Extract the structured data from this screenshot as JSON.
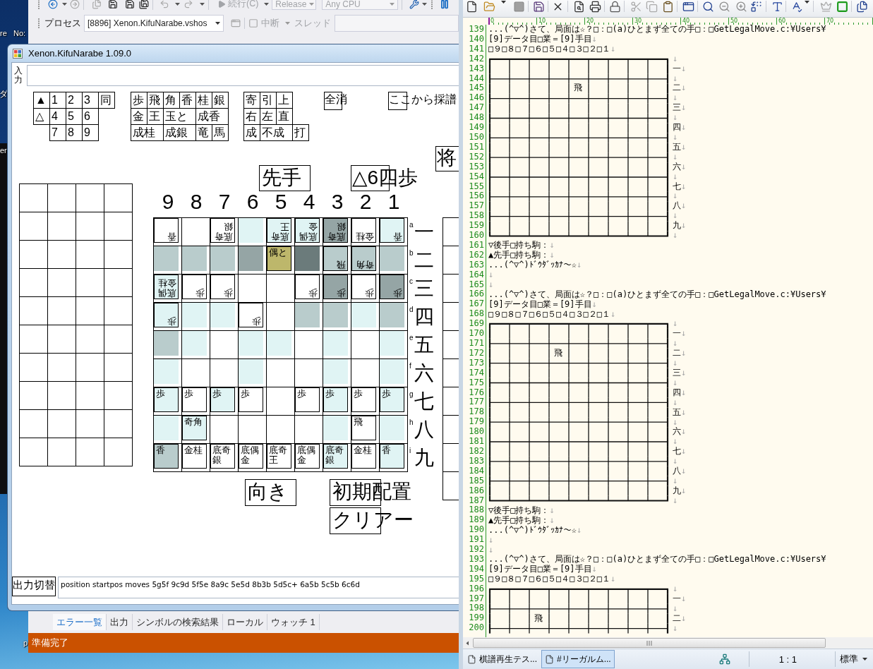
{
  "desktop": {
    "labels": [
      "re",
      "No:",
      "ダ",
      "er",
      "p"
    ]
  },
  "ide": {
    "toolbar": {
      "continue": {
        "label": "続行(C)",
        "disabled": true
      },
      "configuration": {
        "value": "Release",
        "disabled": true
      },
      "platform": {
        "value": "Any CPU",
        "disabled": true
      },
      "process_label": "プロセス",
      "process": "[8896] Xenon.KifuNarabe.vshos",
      "break": {
        "label": "中断",
        "disabled": true
      },
      "thread": {
        "label": "スレッド",
        "disabled": true
      }
    },
    "tool_tabs": [
      {
        "label": "エラー一覧",
        "selected": true
      },
      {
        "label": "出力",
        "selected": false
      },
      {
        "label": "シンボルの検索結果",
        "selected": false
      },
      {
        "label": "ローカル",
        "selected": false
      },
      {
        "label": "ウォッチ 1",
        "selected": false
      }
    ],
    "status": "準備完了"
  },
  "kifu_window": {
    "title": "Xenon.KifuNarabe 1.09.0",
    "input_label": "入力",
    "key_groups": [
      {
        "rows": [
          {
            "keys": [
              {
                "kind": "key",
                "label": "▲"
              },
              {
                "kind": "key",
                "label": "1"
              },
              {
                "kind": "key",
                "label": "2"
              },
              {
                "kind": "key",
                "label": "3"
              },
              {
                "kind": "key",
                "label": "同"
              }
            ]
          },
          {
            "keys": [
              {
                "kind": "key",
                "label": "△"
              },
              {
                "kind": "key",
                "label": "4"
              },
              {
                "kind": "key",
                "label": "5"
              },
              {
                "kind": "key",
                "label": "6"
              }
            ]
          },
          {
            "keys": [
              {
                "kind": "gap"
              },
              {
                "kind": "key",
                "label": "7"
              },
              {
                "kind": "key",
                "label": "8"
              },
              {
                "kind": "key",
                "label": "9"
              }
            ]
          }
        ]
      },
      {
        "rows": [
          {
            "keys": [
              {
                "kind": "key",
                "label": "歩"
              },
              {
                "kind": "key",
                "label": "飛"
              },
              {
                "kind": "key",
                "label": "角"
              },
              {
                "kind": "key",
                "label": "香"
              },
              {
                "kind": "key",
                "label": "桂"
              },
              {
                "kind": "key",
                "label": "銀"
              }
            ]
          },
          {
            "keys": [
              {
                "kind": "key",
                "label": "金"
              },
              {
                "kind": "key",
                "label": "王"
              },
              {
                "kind": "key",
                "label": "玉と",
                "wide": true
              },
              {
                "kind": "key",
                "label": "成香",
                "wide": true
              }
            ]
          },
          {
            "keys": [
              {
                "kind": "key",
                "label": "成桂",
                "wide": true
              },
              {
                "kind": "key",
                "label": "成銀",
                "wide": true
              },
              {
                "kind": "key",
                "label": "竜"
              },
              {
                "kind": "key",
                "label": "馬"
              }
            ]
          }
        ]
      },
      {
        "rows": [
          {
            "keys": [
              {
                "kind": "key",
                "label": "寄"
              },
              {
                "kind": "key",
                "label": "引"
              },
              {
                "kind": "key",
                "label": "上"
              }
            ]
          },
          {
            "keys": [
              {
                "kind": "key",
                "label": "右"
              },
              {
                "kind": "key",
                "label": "左"
              },
              {
                "kind": "key",
                "label": "直"
              }
            ]
          },
          {
            "keys": [
              {
                "kind": "key",
                "label": "成"
              },
              {
                "kind": "key",
                "label": "不成",
                "wide": true
              },
              {
                "kind": "key",
                "label": "打"
              }
            ]
          }
        ]
      }
    ],
    "clear_button": "全消",
    "record_button": "ここから採譜",
    "side_button": "将",
    "turn_button": "先手",
    "last_move": "△6四歩",
    "board": {
      "files": [
        "9",
        "8",
        "7",
        "6",
        "5",
        "4",
        "3",
        "2",
        "1"
      ],
      "ranks": [
        {
          "letter": "a",
          "kanji": "一"
        },
        {
          "letter": "b",
          "kanji": "二"
        },
        {
          "letter": "c",
          "kanji": "三"
        },
        {
          "letter": "d",
          "kanji": "四"
        },
        {
          "letter": "e",
          "kanji": "五"
        },
        {
          "letter": "f",
          "kanji": "六"
        },
        {
          "letter": "g",
          "kanji": "七"
        },
        {
          "letter": "h",
          "kanji": "八"
        },
        {
          "letter": "i",
          "kanji": "九"
        }
      ],
      "squares": [
        [
          {
            "occupied": true,
            "label": "香",
            "inverted": true
          },
          {
            "occupied": false
          },
          {
            "occupied": true,
            "label": "底奇銀",
            "inverted": true
          },
          {
            "occupied": false,
            "color": "#e0f4f4"
          },
          {
            "occupied": true,
            "label": "底奇王",
            "inverted": true,
            "color": "#e0f4f4"
          },
          {
            "occupied": true,
            "label": "底偶金",
            "inverted": true,
            "color": "#e0f4f4"
          },
          {
            "occupied": true,
            "label": "底奇銀",
            "inverted": true,
            "color": "#95a5a5"
          },
          {
            "occupied": true,
            "label": "金桂",
            "inverted": true
          },
          {
            "occupied": true,
            "label": "香",
            "inverted": true,
            "color": "#e0f4f4"
          }
        ],
        [
          {
            "occupied": false,
            "color": "#b9cccc"
          },
          {
            "occupied": false,
            "color": "#b9cccc"
          },
          {
            "occupied": false,
            "color": "#b9cccc"
          },
          {
            "occupied": false,
            "color": "#95a5a5"
          },
          {
            "occupied": true,
            "label": "偶と",
            "inverted": false,
            "color": "#bdb76b"
          },
          {
            "occupied": false,
            "color": "#6b7b7b"
          },
          {
            "occupied": true,
            "label": "飛",
            "inverted": true,
            "color": "#b9cccc"
          },
          {
            "occupied": true,
            "label": "奇角",
            "inverted": true,
            "color": "#b9cccc"
          },
          {
            "occupied": false,
            "color": "#b9cccc"
          }
        ],
        [
          {
            "occupied": true,
            "label": "底偶金桂",
            "inverted": true,
            "color": "#e0f4f4"
          },
          {
            "occupied": true,
            "label": "歩",
            "inverted": true
          },
          {
            "occupied": true,
            "label": "歩",
            "inverted": true
          },
          {
            "occupied": false
          },
          {
            "occupied": false
          },
          {
            "occupied": true,
            "label": "歩",
            "inverted": true
          },
          {
            "occupied": true,
            "label": "歩",
            "inverted": true,
            "color": "#95a5a5"
          },
          {
            "occupied": true,
            "label": "歩",
            "inverted": true
          },
          {
            "occupied": true,
            "label": "歩",
            "inverted": true,
            "color": "#95a5a5"
          }
        ],
        [
          {
            "occupied": true,
            "label": "歩",
            "inverted": true,
            "color": "#e0f4f4"
          },
          {
            "occupied": false,
            "color": "#e0f4f4"
          },
          {
            "occupied": false,
            "color": "#e0f4f4"
          },
          {
            "occupied": true,
            "label": "歩",
            "inverted": true
          },
          {
            "occupied": false
          },
          {
            "occupied": false,
            "color": "#b9cccc"
          },
          {
            "occupied": false,
            "color": "#b9cccc"
          },
          {
            "occupied": false,
            "color": "#e0f4f4"
          },
          {
            "occupied": false,
            "color": "#b9cccc"
          }
        ],
        [
          {
            "occupied": false,
            "color": "#b9cccc"
          },
          {
            "occupied": false,
            "color": "#e0f4f4"
          },
          {
            "occupied": false
          },
          {
            "occupied": false,
            "color": "#e0f4f4"
          },
          {
            "occupied": false,
            "color": "#e0f4f4"
          },
          {
            "occupied": false
          },
          {
            "occupied": false,
            "color": "#e0f4f4"
          },
          {
            "occupied": false
          },
          {
            "occupied": false,
            "color": "#e0f4f4"
          }
        ],
        [
          {
            "occupied": false,
            "color": "#e0f4f4"
          },
          {
            "occupied": false
          },
          {
            "occupied": false
          },
          {
            "occupied": false,
            "color": "#e0f4f4"
          },
          {
            "occupied": false
          },
          {
            "occupied": false
          },
          {
            "occupied": false,
            "color": "#e0f4f4"
          },
          {
            "occupied": false
          },
          {
            "occupied": false,
            "color": "#e0f4f4"
          }
        ],
        [
          {
            "occupied": true,
            "label": "歩",
            "inverted": false,
            "color": "#e0f4f4"
          },
          {
            "occupied": true,
            "label": "歩",
            "inverted": false
          },
          {
            "occupied": true,
            "label": "歩",
            "inverted": false,
            "color": "#e0f4f4"
          },
          {
            "occupied": true,
            "label": "歩",
            "inverted": false
          },
          {
            "occupied": false
          },
          {
            "occupied": true,
            "label": "歩",
            "inverted": false
          },
          {
            "occupied": true,
            "label": "歩",
            "inverted": false,
            "color": "#e0f4f4"
          },
          {
            "occupied": true,
            "label": "歩",
            "inverted": false
          },
          {
            "occupied": true,
            "label": "歩",
            "inverted": false,
            "color": "#e0f4f4"
          }
        ],
        [
          {
            "occupied": false,
            "color": "#e0f4f4"
          },
          {
            "occupied": true,
            "label": "奇角",
            "inverted": false,
            "color": "#e0f4f4"
          },
          {
            "occupied": false
          },
          {
            "occupied": false
          },
          {
            "occupied": false
          },
          {
            "occupied": false
          },
          {
            "occupied": false,
            "color": "#e0f4f4"
          },
          {
            "occupied": true,
            "label": "飛",
            "inverted": false
          },
          {
            "occupied": false,
            "color": "#e0f4f4"
          }
        ],
        [
          {
            "occupied": true,
            "label": "香",
            "inverted": false,
            "color": "#b9cccc"
          },
          {
            "occupied": true,
            "label": "金桂",
            "inverted": false
          },
          {
            "occupied": true,
            "label": "底奇銀",
            "inverted": false
          },
          {
            "occupied": true,
            "label": "底偶金",
            "inverted": false
          },
          {
            "occupied": true,
            "label": "底奇王",
            "inverted": false
          },
          {
            "occupied": true,
            "label": "底偶金",
            "inverted": false
          },
          {
            "occupied": true,
            "label": "底奇銀",
            "inverted": false,
            "color": "#e0f4f4"
          },
          {
            "occupied": true,
            "label": "金桂",
            "inverted": false
          },
          {
            "occupied": true,
            "label": "香",
            "inverted": false,
            "color": "#e0f4f4"
          }
        ]
      ]
    },
    "direction_button": "向き",
    "setup_button": "初期配置",
    "clear_board_button": "クリアー",
    "output_button": "出力切替",
    "output": "position startpos moves 5g5f 9c9d 5f5e 8a9c 5e5d 8b3b 5d5c+ 6a5b 5c5b 6c6d"
  },
  "editor": {
    "ruler": [
      "0",
      "10",
      "20",
      "30",
      "40",
      "50",
      "60",
      "70"
    ],
    "blocks": [
      {
        "kind": "text",
        "lines": [
          {
            "no": "139",
            "text": "...(^▽^)さて、局面は☆？□：□(a)ひとまず全ての手□：□GetLegalMove.c:¥Users¥"
          },
          {
            "no": "140",
            "text": "[9]データ目□業＝[9]手目",
            "eol": "↓"
          },
          {
            "no": "141",
            "text": "□９□８□７□６□５□４□３□２□１",
            "eol": "↓"
          }
        ]
      },
      {
        "kind": "board",
        "rows": [
          {
            "no": "142",
            "kind": "top",
            "eol": "↓"
          },
          {
            "no": "143",
            "kind": "rank",
            "rank": "一",
            "eol": "↓"
          },
          {
            "no": "144",
            "kind": "rule",
            "eol": "↓"
          },
          {
            "no": "145",
            "kind": "rank",
            "rank": "二",
            "eol": "↓",
            "cells": "　　　　飛"
          },
          {
            "no": "146",
            "kind": "rule",
            "eol": "↓"
          },
          {
            "no": "147",
            "kind": "rank",
            "rank": "三",
            "eol": "↓"
          },
          {
            "no": "148",
            "kind": "rule",
            "eol": "↓"
          },
          {
            "no": "149",
            "kind": "rank",
            "rank": "四",
            "eol": "↓"
          },
          {
            "no": "150",
            "kind": "rule",
            "eol": "↓"
          },
          {
            "no": "151",
            "kind": "rank",
            "rank": "五",
            "eol": "↓"
          },
          {
            "no": "152",
            "kind": "rule",
            "eol": "↓"
          },
          {
            "no": "153",
            "kind": "rank",
            "rank": "六",
            "eol": "↓"
          },
          {
            "no": "154",
            "kind": "rule",
            "eol": "↓"
          },
          {
            "no": "155",
            "kind": "rank",
            "rank": "七",
            "eol": "↓"
          },
          {
            "no": "156",
            "kind": "rule",
            "eol": "↓"
          },
          {
            "no": "157",
            "kind": "rank",
            "rank": "八",
            "eol": "↓"
          },
          {
            "no": "158",
            "kind": "rule",
            "eol": "↓"
          },
          {
            "no": "159",
            "kind": "rank",
            "rank": "九",
            "eol": "↓"
          },
          {
            "no": "160",
            "kind": "bottom",
            "eol": "↓"
          }
        ]
      },
      {
        "kind": "text",
        "lines": [
          {
            "no": "161",
            "text": "▽後手□持ち駒：",
            "eol": "↓"
          },
          {
            "no": "162",
            "text": "▲先手□持ち駒：",
            "eol": "↓"
          },
          {
            "no": "163",
            "text": "...(^▽^)ﾄﾞｳﾀﾞｯｶﾅ～☆",
            "eol": "↓"
          },
          {
            "no": "164",
            "eol": "↓"
          },
          {
            "no": "165",
            "eol": "↓"
          },
          {
            "no": "166",
            "text": "...(^▽^)さて、局面は☆？□：□(a)ひとまず全ての手□：□GetLegalMove.c:¥Users¥"
          },
          {
            "no": "167",
            "text": "[9]データ目□業＝[9]手目",
            "eol": "↓"
          },
          {
            "no": "168",
            "text": "□９□８□７□６□５□４□３□２□１",
            "eol": "↓"
          }
        ]
      },
      {
        "kind": "board",
        "rows": [
          {
            "no": "169",
            "kind": "top",
            "eol": "↓"
          },
          {
            "no": "170",
            "kind": "rank",
            "rank": "一",
            "eol": "↓"
          },
          {
            "no": "171",
            "kind": "rule",
            "eol": "↓"
          },
          {
            "no": "172",
            "kind": "rank",
            "rank": "二",
            "eol": "↓",
            "cells": "　　　飛"
          },
          {
            "no": "173",
            "kind": "rule",
            "eol": "↓"
          },
          {
            "no": "174",
            "kind": "rank",
            "rank": "三",
            "eol": "↓"
          },
          {
            "no": "175",
            "kind": "rule",
            "eol": "↓"
          },
          {
            "no": "176",
            "kind": "rank",
            "rank": "四",
            "eol": "↓"
          },
          {
            "no": "177",
            "kind": "rule",
            "eol": "↓"
          },
          {
            "no": "178",
            "kind": "rank",
            "rank": "五",
            "eol": "↓"
          },
          {
            "no": "179",
            "kind": "rule",
            "eol": "↓"
          },
          {
            "no": "180",
            "kind": "rank",
            "rank": "六",
            "eol": "↓"
          },
          {
            "no": "181",
            "kind": "rule",
            "eol": "↓"
          },
          {
            "no": "182",
            "kind": "rank",
            "rank": "七",
            "eol": "↓"
          },
          {
            "no": "183",
            "kind": "rule",
            "eol": "↓"
          },
          {
            "no": "184",
            "kind": "rank",
            "rank": "八",
            "eol": "↓"
          },
          {
            "no": "185",
            "kind": "rule",
            "eol": "↓"
          },
          {
            "no": "186",
            "kind": "rank",
            "rank": "九",
            "eol": "↓"
          },
          {
            "no": "187",
            "kind": "bottom",
            "eol": "↓"
          }
        ]
      },
      {
        "kind": "text",
        "lines": [
          {
            "no": "188",
            "text": "▽後手□持ち駒：",
            "eol": "↓"
          },
          {
            "no": "189",
            "text": "▲先手□持ち駒：",
            "eol": "↓"
          },
          {
            "no": "190",
            "text": "...(^▽^)ﾄﾞｳﾀﾞｯｶﾅ～☆",
            "eol": "↓"
          },
          {
            "no": "191",
            "eol": "↓"
          },
          {
            "no": "192",
            "eol": "↓"
          },
          {
            "no": "193",
            "text": "...(^▽^)さて、局面は☆？□：□(a)ひとまず全ての手□：□GetLegalMove.c:¥Users¥"
          },
          {
            "no": "194",
            "text": "[9]データ目□業＝[9]手目",
            "eol": "↓"
          },
          {
            "no": "195",
            "text": "□９□８□７□６□５□４□３□２□１",
            "eol": "↓"
          }
        ]
      },
      {
        "kind": "board",
        "rows": [
          {
            "no": "196",
            "kind": "top",
            "eol": "↓"
          },
          {
            "no": "197",
            "kind": "rank",
            "rank": "一",
            "eol": "↓"
          },
          {
            "no": "198",
            "kind": "rule",
            "eol": "↓"
          },
          {
            "no": "199",
            "kind": "rank",
            "rank": "二",
            "eol": "↓",
            "cells": "　　飛"
          },
          {
            "no": "200",
            "kind": "rule",
            "eol": "↓"
          }
        ]
      }
    ],
    "tabs": [
      {
        "label": "棋譜再生テス...",
        "selected": false
      },
      {
        "label": "#リーガルム...",
        "selected": true
      }
    ],
    "position": "1 : 1",
    "mode": "標準"
  }
}
